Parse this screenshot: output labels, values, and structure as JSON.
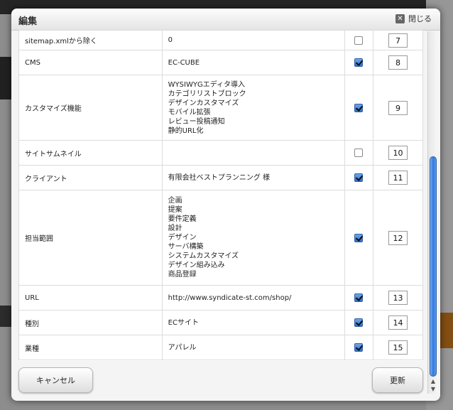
{
  "dialog": {
    "title": "編集",
    "close_label": "閉じる",
    "cancel_label": "キャンセル",
    "update_label": "更新"
  },
  "rows": [
    {
      "label": "sitemap.xmlから除く",
      "value": [
        "0"
      ],
      "checked": false,
      "order": "7"
    },
    {
      "label": "CMS",
      "value": [
        "EC-CUBE"
      ],
      "checked": true,
      "order": "8"
    },
    {
      "label": "カスタマイズ機能",
      "value": [
        "WYSIWYGエディタ導入",
        "カテゴリリストブロック",
        "デザインカスタマイズ",
        "モバイル拡張",
        "レビュー投稿通知",
        "静的URL化"
      ],
      "checked": true,
      "order": "9"
    },
    {
      "label": "サイトサムネイル",
      "value": [],
      "checked": false,
      "order": "10"
    },
    {
      "label": "クライアント",
      "value": [
        "有限会社ベストプランニング 様"
      ],
      "checked": true,
      "order": "11"
    },
    {
      "label": "担当範囲",
      "value": [
        "企画",
        "提案",
        "要件定義",
        "設計",
        "デザイン",
        "サーバ構築",
        "システムカスタマイズ",
        "デザイン組み込み",
        "商品登録"
      ],
      "checked": true,
      "order": "12"
    },
    {
      "label": "URL",
      "value": [
        "http://www.syndicate-st.com/shop/"
      ],
      "checked": true,
      "order": "13"
    },
    {
      "label": "種別",
      "value": [
        "ECサイト"
      ],
      "checked": true,
      "order": "14"
    },
    {
      "label": "業種",
      "value": [
        "アパレル"
      ],
      "checked": true,
      "order": "15"
    }
  ],
  "colors": {
    "accent": "#2a6fcd",
    "scroll_thumb": "#2f7ae0"
  }
}
